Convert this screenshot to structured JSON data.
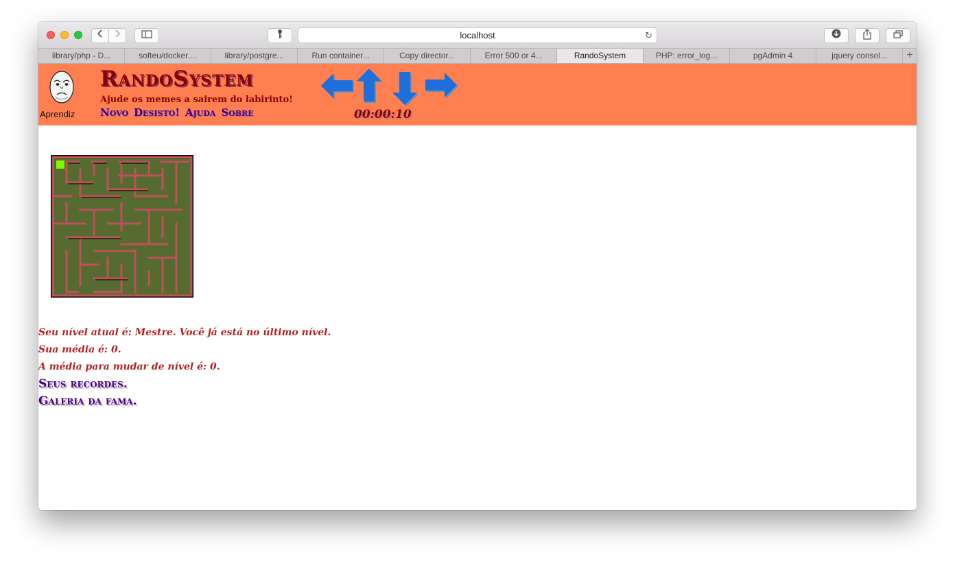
{
  "browser": {
    "url": "localhost",
    "tabs": [
      {
        "label": "library/php - D..."
      },
      {
        "label": "softeu/docker...."
      },
      {
        "label": "library/postgre..."
      },
      {
        "label": "Run container..."
      },
      {
        "label": "Copy director..."
      },
      {
        "label": "Error 500 or 4..."
      },
      {
        "label": "RandoSystem"
      },
      {
        "label": "PHP: error_log..."
      },
      {
        "label": "pgAdmin 4"
      },
      {
        "label": "jquery consol..."
      }
    ],
    "active_tab": "RandoSystem",
    "add_tab_label": "+"
  },
  "header": {
    "level_label": "Aprendiz",
    "title": "RandoSystem",
    "subtitle": "Ajude os memes a sairem do labirinto!",
    "menu": [
      {
        "label": "Novo"
      },
      {
        "label": "Desisto!"
      },
      {
        "label": "Ajuda"
      },
      {
        "label": "Sobre"
      }
    ],
    "timer": "00:00:10",
    "arrows": [
      "left",
      "up",
      "down",
      "right"
    ],
    "arrow_color": "#1e6fd9",
    "bg_color": "#ff7f50"
  },
  "maze": {
    "wall_color": "#c0505a",
    "floor_color": "#556b2f",
    "player_color": "#7cfc00"
  },
  "info": {
    "level_text": "Seu nível atual é: Mestre. Você já está no último nível.",
    "average_text": "Sua média é: 0.",
    "change_text": "A média para mudar de nível é: 0.",
    "records_link": "Seus recordes.",
    "fame_link": "Galeria da fama."
  }
}
